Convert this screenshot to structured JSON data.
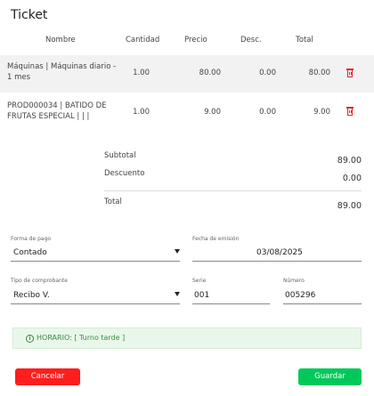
{
  "title": "Ticket",
  "table": {
    "headers": {
      "name": "Nombre",
      "qty": "Cantidad",
      "price": "Precio",
      "disc": "Desc.",
      "total": "Total"
    },
    "rows": [
      {
        "name": "Máquinas | Máquinas diario - 1 mes",
        "qty": "1.00",
        "price": "80.00",
        "disc": "0.00",
        "total": "80.00",
        "icon": "trash-icon"
      },
      {
        "name": "PROD000034 | BATIDO DE FRUTAS ESPECIAL | | |",
        "qty": "1.00",
        "price": "9.00",
        "disc": "0.00",
        "total": "9.00",
        "icon": "trash-icon"
      }
    ]
  },
  "summary": {
    "subtotal_label": "Subtotal",
    "subtotal_value": "89.00",
    "discount_label": "Descuento",
    "discount_value": "0.00",
    "total_label": "Total",
    "total_value": "89.00"
  },
  "form": {
    "payment": {
      "label": "Forma de pago",
      "value": "Contado"
    },
    "issue_date": {
      "label": "Fecha de emisión",
      "value": "03/08/2025"
    },
    "voucher_type": {
      "label": "Tipo de comprobante",
      "value": "Recibo V."
    },
    "series": {
      "label": "Serie",
      "value": "001"
    },
    "number": {
      "label": "Número",
      "value": "005296"
    }
  },
  "alert": {
    "icon": "info-icon",
    "text": "HORARIO: [ Turno tarde ]"
  },
  "buttons": {
    "cancel": "Cancelar",
    "save": "Guardar"
  },
  "colors": {
    "danger": "#ff1d1d",
    "success": "#00c95a",
    "alert_bg": "#e9f7ea",
    "alert_text": "#3c8c42"
  }
}
